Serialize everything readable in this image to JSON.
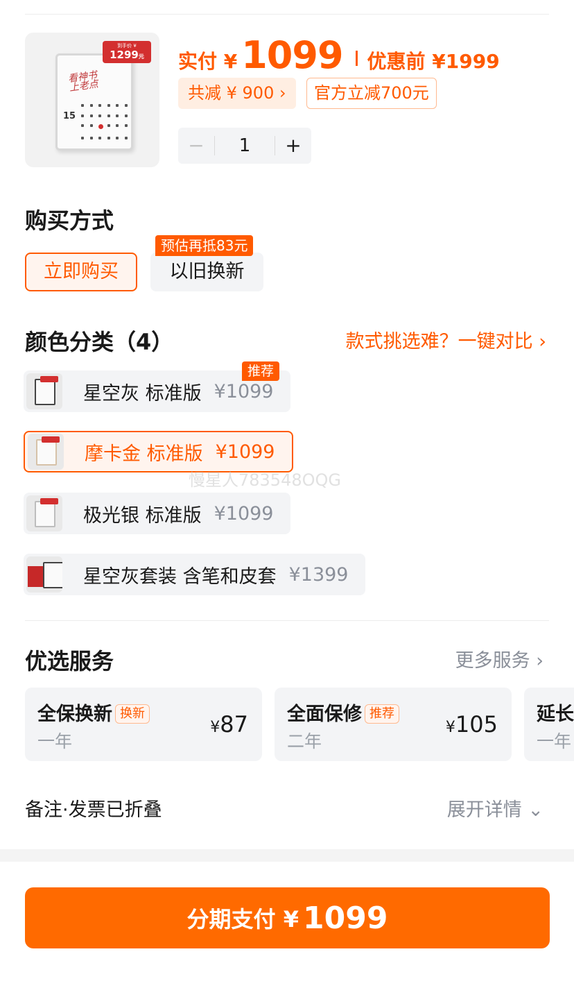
{
  "product": {
    "thumb_tag_small": "到手价 ¥",
    "thumb_tag_price": "1299",
    "thumb_tag_unit": "元",
    "thumb_screen_text": "看神书 上老点",
    "thumb_date": "15",
    "pay_label": "实付 ¥",
    "pay_value": "1099",
    "orig_price": "优惠前 ¥1999",
    "discount_total": "共减 ¥ 900 ›",
    "discount_official": "官方立减700元",
    "quantity": "1",
    "minus": "−",
    "plus": "+"
  },
  "purchase": {
    "title": "购买方式",
    "options": [
      {
        "label": "立即购买"
      },
      {
        "label": "以旧换新",
        "badge": "预估再抵83元"
      }
    ]
  },
  "colors": {
    "title": "颜色分类（4）",
    "compare_link": "款式挑选难？一键对比 ›",
    "items": [
      {
        "name": "星空灰 标准版",
        "price": "¥1099",
        "badge": "推荐"
      },
      {
        "name": "摩卡金 标准版",
        "price": "¥1099"
      },
      {
        "name": "极光银 标准版",
        "price": "¥1099"
      },
      {
        "name": "星空灰套装 含笔和皮套",
        "price": "¥1399"
      }
    ]
  },
  "services": {
    "title": "优选服务",
    "more_link": "更多服务 ›",
    "cards": [
      {
        "name": "全保换新",
        "badge": "换新",
        "term": "一年",
        "yen": "¥",
        "price": "87"
      },
      {
        "name": "全面保修",
        "badge": "推荐",
        "term": "二年",
        "yen": "¥",
        "price": "105"
      },
      {
        "name": "延长",
        "term": "一年"
      }
    ]
  },
  "notes": {
    "label": "备注·发票已折叠",
    "expand": "展开详情 ⌄"
  },
  "footer": {
    "pay_label": "分期支付 ¥",
    "pay_amount": "1099"
  },
  "watermark": "慢星人783548OQG",
  "colors_palette": {
    "accent": "#ff5a00",
    "button": "#ff6a00",
    "chip_bg": "#f3f4f6",
    "muted": "#8a8f99"
  }
}
